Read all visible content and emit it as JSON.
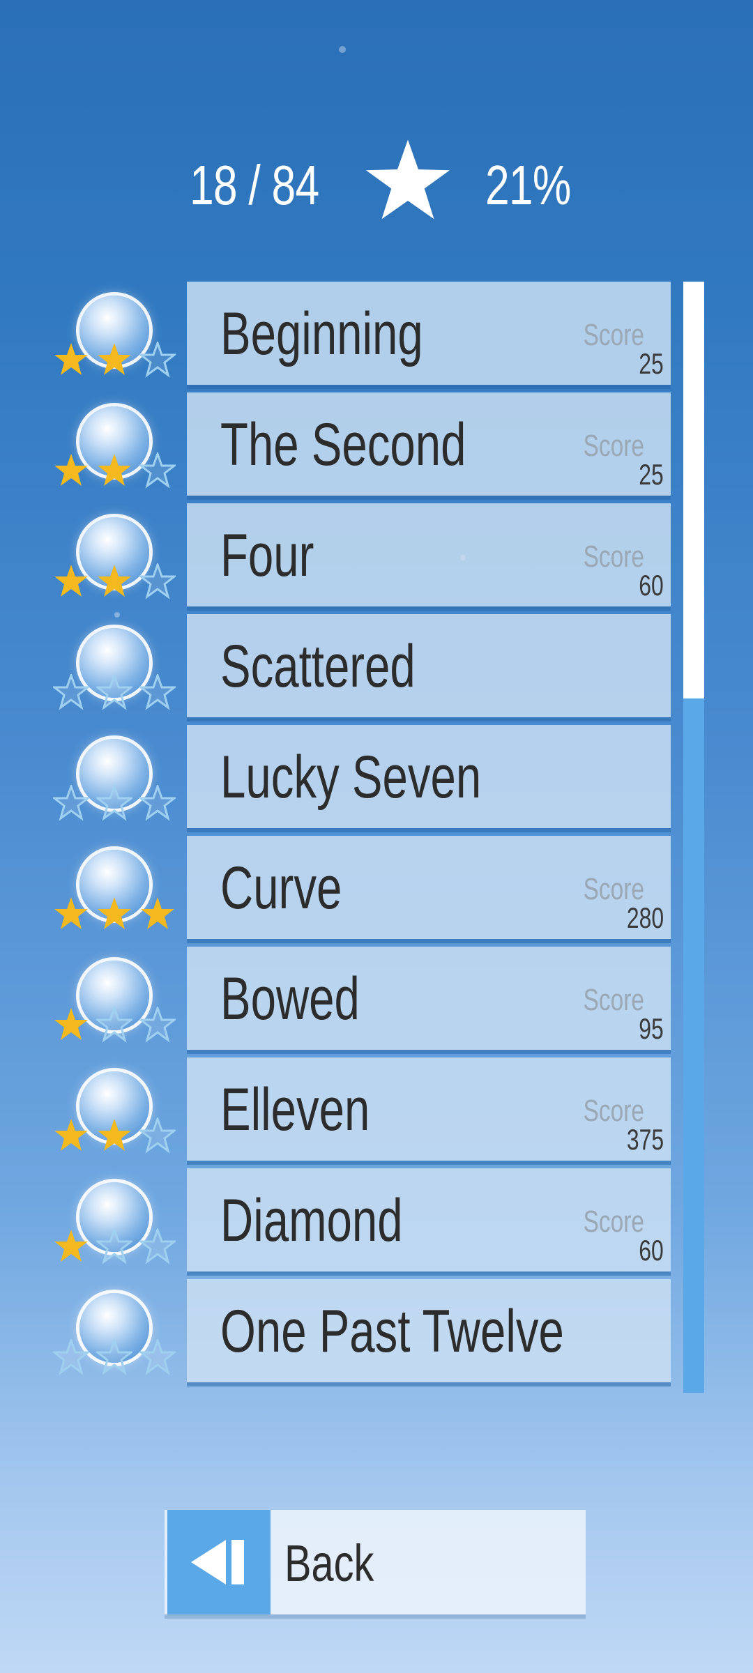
{
  "header": {
    "progress_text": "18 / 84",
    "percent_text": "21%",
    "stars_collected": 18,
    "stars_total": 84,
    "star_icon": "star-icon"
  },
  "levels": [
    {
      "title": "Beginning",
      "stars": 2,
      "score_label": "Score",
      "score": "25"
    },
    {
      "title": "The Second",
      "stars": 2,
      "score_label": "Score",
      "score": "25"
    },
    {
      "title": "Four",
      "stars": 2,
      "score_label": "Score",
      "score": "60"
    },
    {
      "title": "Scattered",
      "stars": 0,
      "score_label": "",
      "score": ""
    },
    {
      "title": "Lucky Seven",
      "stars": 0,
      "score_label": "",
      "score": ""
    },
    {
      "title": "Curve",
      "stars": 3,
      "score_label": "Score",
      "score": "280"
    },
    {
      "title": "Bowed",
      "stars": 1,
      "score_label": "Score",
      "score": "95"
    },
    {
      "title": "Elleven",
      "stars": 2,
      "score_label": "Score",
      "score": "375"
    },
    {
      "title": "Diamond",
      "stars": 1,
      "score_label": "Score",
      "score": "60"
    },
    {
      "title": "One Past Twelve",
      "stars": 0,
      "score_label": "",
      "score": ""
    }
  ],
  "scroll": {
    "visible_fraction": 0.375
  },
  "back": {
    "label": "Back",
    "icon": "back-icon"
  },
  "colors": {
    "star_filled": "#f4b91e",
    "star_empty_outline": "#9fd0ef",
    "accent": "#5aa8e8"
  }
}
